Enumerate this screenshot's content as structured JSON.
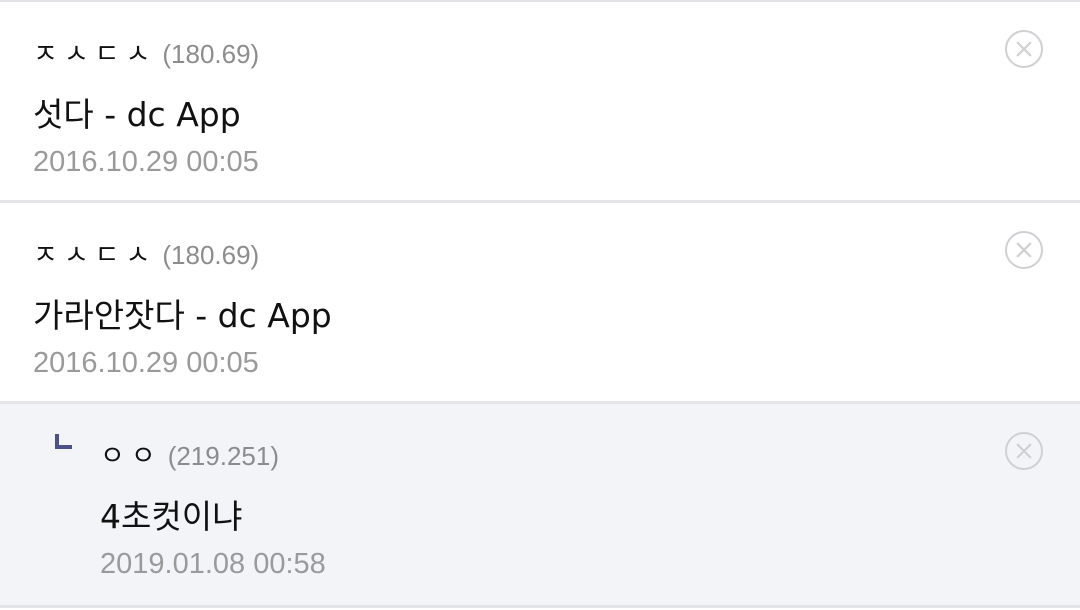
{
  "comments": [
    {
      "nickname": "ㅈㅅㄷㅅ",
      "ip": "(180.69)",
      "text": "섯다 - dc App",
      "date": "2016.10.29 00:05",
      "is_reply": false
    },
    {
      "nickname": "ㅈㅅㄷㅅ",
      "ip": "(180.69)",
      "text": "가라안잣다 - dc App",
      "date": "2016.10.29 00:05",
      "is_reply": false
    },
    {
      "nickname": "ㅇㅇ",
      "ip": "(219.251)",
      "text": "4초컷이냐",
      "date": "2019.01.08 00:58",
      "is_reply": true
    }
  ],
  "icons": {
    "delete": "close-circle-icon",
    "reply": "reply-arrow-icon"
  },
  "colors": {
    "reply_background": "#f3f4f8",
    "reply_mark": "#4a5289",
    "ip_text": "#8c8c8c",
    "date_text": "#9a9a9a"
  }
}
